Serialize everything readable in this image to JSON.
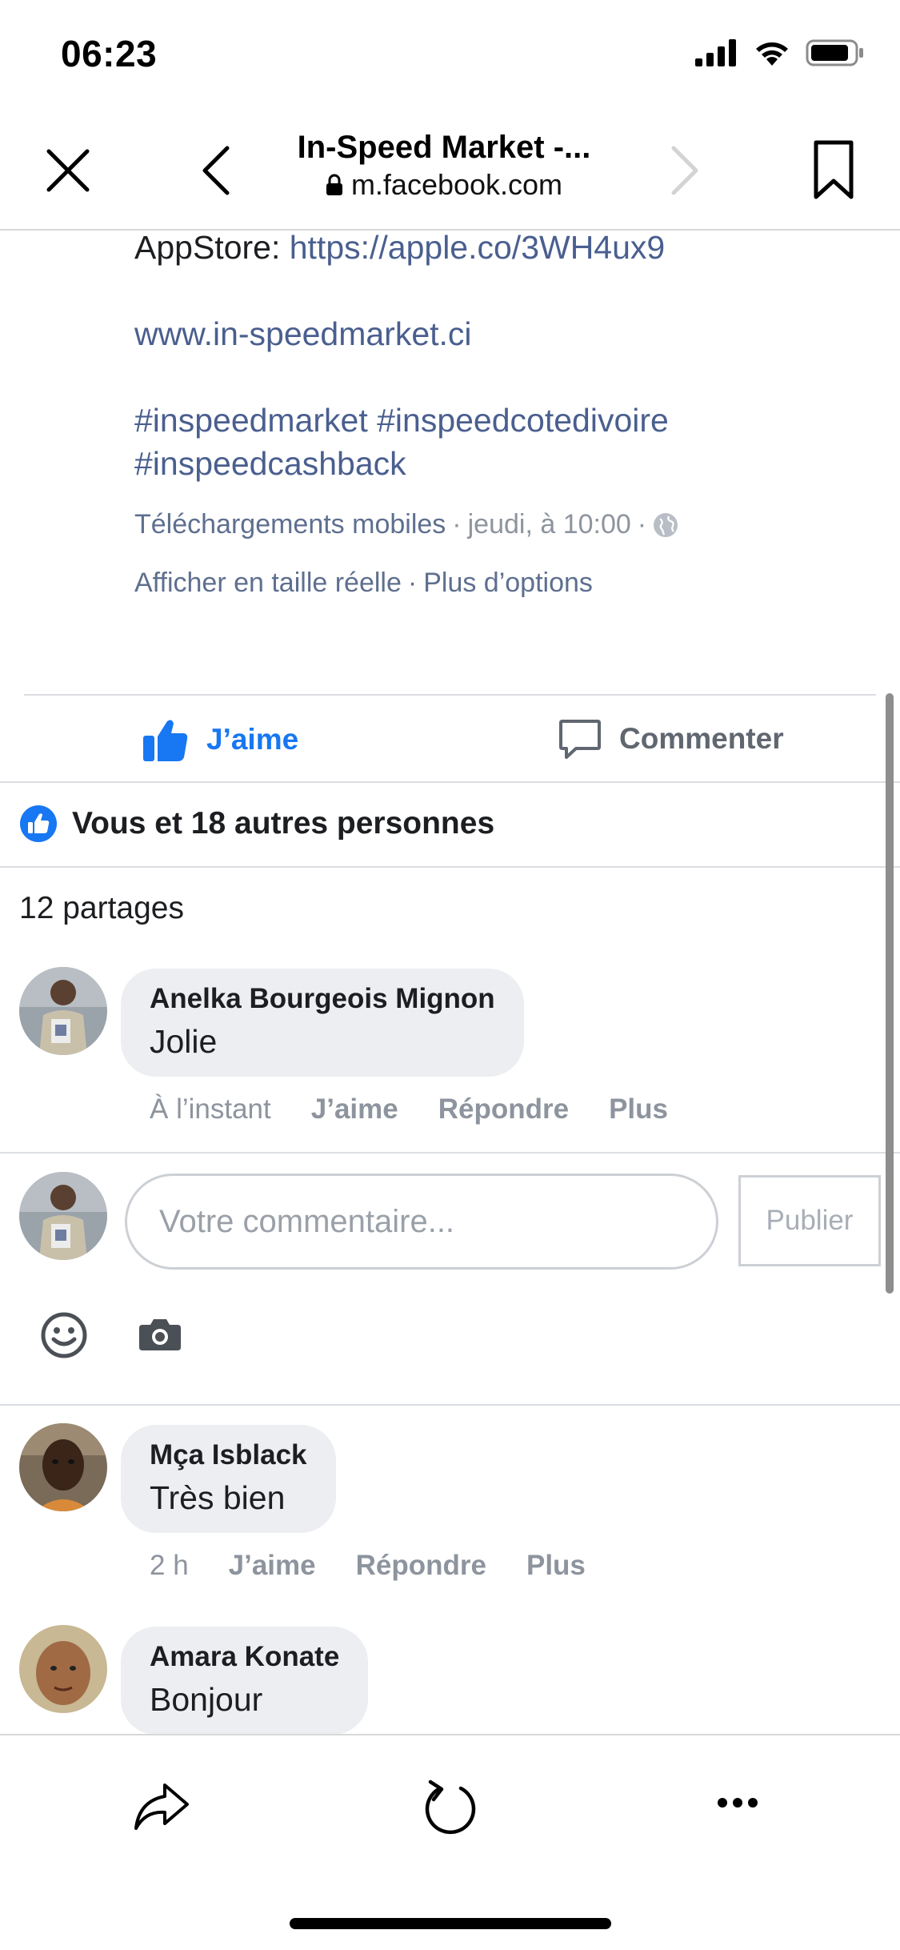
{
  "status_bar": {
    "time": "06:23"
  },
  "browser": {
    "title": "In-Speed Market -...",
    "url": "m.facebook.com"
  },
  "post": {
    "appstore_label": "AppStore: ",
    "appstore_link": "https://apple.co/3WH4ux9",
    "website": "www.in-speedmarket.ci",
    "hashtags_line1": "#inspeedmarket #inspeedcotedivoire",
    "hashtags_line2": "#inspeedcashback",
    "album": "Téléchargements mobiles",
    "sep1": "·",
    "timestamp": "jeudi, à 10:00",
    "sep2": "·",
    "view_full": "Afficher en taille réelle",
    "sep3": "·",
    "more_options": "Plus d’options"
  },
  "actions": {
    "like_label": "J’aime",
    "comment_label": "Commenter"
  },
  "reactions": {
    "likes_text": "Vous et 18 autres personnes",
    "shares_text": "12 partages"
  },
  "comments": [
    {
      "author": "Anelka Bourgeois Mignon",
      "text": "Jolie",
      "time": "À l’instant",
      "like": "J’aime",
      "reply": "Répondre",
      "more": "Plus"
    },
    {
      "author": "Mça Isblack",
      "text": "Très bien",
      "time": "2 h",
      "like": "J’aime",
      "reply": "Répondre",
      "more": "Plus"
    },
    {
      "author": "Amara Konate",
      "text": "Bonjour"
    }
  ],
  "composer": {
    "placeholder": "Votre commentaire...",
    "publish_label": "Publier"
  },
  "colors": {
    "facebook_blue": "#1877f2",
    "link": "#4a5f8f",
    "meta_grey": "#8d949e",
    "bubble": "#eceef1"
  }
}
